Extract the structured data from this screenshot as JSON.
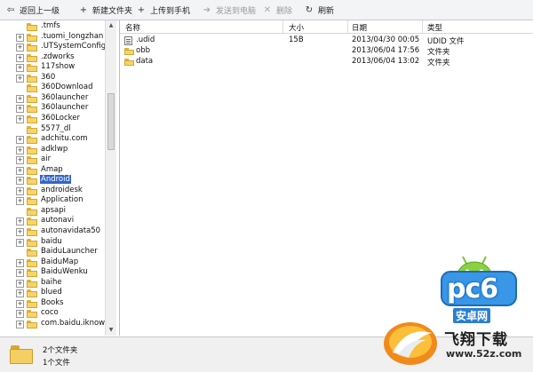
{
  "toolbar": {
    "items": [
      {
        "label": "返回上一级",
        "icon": "back-folder-icon",
        "glyph": "⇦",
        "disabled": false
      },
      {
        "label": "新建文件夹",
        "icon": "plus-icon",
        "glyph": "+",
        "disabled": false
      },
      {
        "label": "上传到手机",
        "icon": "plus-icon",
        "glyph": "+",
        "disabled": false
      },
      {
        "label": "发送到电脑",
        "icon": "send-arrow-icon",
        "glyph": "➜",
        "disabled": true
      },
      {
        "label": "删除",
        "icon": "delete-x-icon",
        "glyph": "✕",
        "disabled": true
      },
      {
        "label": "刷新",
        "icon": "refresh-icon",
        "glyph": "↻",
        "disabled": false
      }
    ]
  },
  "tree": {
    "items": [
      {
        "label": ".tmfs",
        "expandable": false,
        "selected": false
      },
      {
        "label": ".tuomi_longzhan",
        "expandable": true,
        "selected": false
      },
      {
        "label": ".UTSystemConfig",
        "expandable": true,
        "selected": false
      },
      {
        "label": ".zdworks",
        "expandable": true,
        "selected": false
      },
      {
        "label": "117show",
        "expandable": true,
        "selected": false
      },
      {
        "label": "360",
        "expandable": true,
        "selected": false
      },
      {
        "label": "360Download",
        "expandable": false,
        "selected": false
      },
      {
        "label": "360launcher",
        "expandable": true,
        "selected": false
      },
      {
        "label": "360launcher",
        "expandable": true,
        "selected": false
      },
      {
        "label": "360Locker",
        "expandable": true,
        "selected": false
      },
      {
        "label": "5577_dl",
        "expandable": false,
        "selected": false
      },
      {
        "label": "adchitu.com",
        "expandable": true,
        "selected": false
      },
      {
        "label": "adklwp",
        "expandable": true,
        "selected": false
      },
      {
        "label": "air",
        "expandable": true,
        "selected": false
      },
      {
        "label": "Amap",
        "expandable": true,
        "selected": false
      },
      {
        "label": "Android",
        "expandable": true,
        "selected": true
      },
      {
        "label": "androidesk",
        "expandable": true,
        "selected": false
      },
      {
        "label": "Application",
        "expandable": true,
        "selected": false
      },
      {
        "label": "apsapi",
        "expandable": false,
        "selected": false
      },
      {
        "label": "autonavi",
        "expandable": true,
        "selected": false
      },
      {
        "label": "autonavidata50",
        "expandable": true,
        "selected": false
      },
      {
        "label": "baidu",
        "expandable": true,
        "selected": false
      },
      {
        "label": "BaiduLauncher",
        "expandable": false,
        "selected": false
      },
      {
        "label": "BaiduMap",
        "expandable": true,
        "selected": false
      },
      {
        "label": "BaiduWenku",
        "expandable": true,
        "selected": false
      },
      {
        "label": "baihe",
        "expandable": true,
        "selected": false
      },
      {
        "label": "blued",
        "expandable": true,
        "selected": false
      },
      {
        "label": "Books",
        "expandable": true,
        "selected": false
      },
      {
        "label": "coco",
        "expandable": true,
        "selected": false
      },
      {
        "label": "com.baidu.iknow",
        "expandable": true,
        "selected": false
      }
    ]
  },
  "list": {
    "headers": {
      "name": "名称",
      "size": "大小",
      "date": "日期",
      "type": "类型"
    },
    "rows": [
      {
        "name": ".udid",
        "size": "15B",
        "date": "2013/04/30 00:05",
        "type": "UDID 文件",
        "kind": "file"
      },
      {
        "name": "obb",
        "size": "",
        "date": "2013/06/04 17:56",
        "type": "文件夹",
        "kind": "folder"
      },
      {
        "name": "data",
        "size": "",
        "date": "2013/06/04 13:02",
        "type": "文件夹",
        "kind": "folder"
      }
    ]
  },
  "status": {
    "folders": "2个文件夹",
    "files": "1个文件"
  },
  "watermark": {
    "brand": "pc6",
    "sub": "安卓网",
    "name": "飞翔下载",
    "url": "www.52z.com"
  }
}
